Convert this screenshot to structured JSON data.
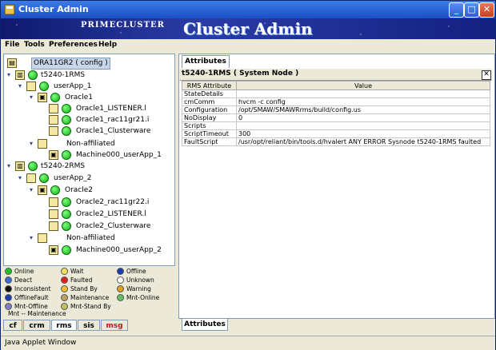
{
  "window": {
    "title": "Cluster Admin",
    "brand": "PRIMECLUSTER",
    "banner_title": "Cluster Admin",
    "buttons": [
      "_",
      "□",
      "✕"
    ]
  },
  "menu": [
    "File",
    "Tools",
    "Preferences",
    "Help"
  ],
  "tree": {
    "root": "ORA11GR2 ( config )",
    "nodes": [
      {
        "label": "t5240-1RMS"
      },
      {
        "label": "userApp_1"
      },
      {
        "label": "Oracle1"
      },
      {
        "label": "Oracle1_LISTENER.l"
      },
      {
        "label": "Oracle1_rac11gr21.i"
      },
      {
        "label": "Oracle1_Clusterware"
      },
      {
        "label": "Non-affiliated"
      },
      {
        "label": "Machine000_userApp_1"
      },
      {
        "label": "t5240-2RMS"
      },
      {
        "label": "userApp_2"
      },
      {
        "label": "Oracle2"
      },
      {
        "label": "Oracle2_rac11gr22.i"
      },
      {
        "label": "Oracle2_LISTENER.l"
      },
      {
        "label": "Oracle2_Clusterware"
      },
      {
        "label": "Non-affiliated"
      },
      {
        "label": "Machine000_userApp_2"
      }
    ]
  },
  "legend": [
    {
      "label": "Online",
      "color": "#22c022"
    },
    {
      "label": "Wait",
      "color": "#f0e060"
    },
    {
      "label": "Offline",
      "color": "#1a3ab0"
    },
    {
      "label": "Deact",
      "color": "#3a6ad0"
    },
    {
      "label": "Faulted",
      "color": "#e02020"
    },
    {
      "label": "Unknown",
      "color": "#ffffff"
    },
    {
      "label": "Inconsistent",
      "color": "#111111"
    },
    {
      "label": "Stand By",
      "color": "#f0c030"
    },
    {
      "label": "Warning",
      "color": "#e0a020"
    },
    {
      "label": "OfflineFault",
      "color": "#1a3ab0"
    },
    {
      "label": "Maintenance",
      "color": "#c0a060"
    },
    {
      "label": "Mnt-Online",
      "color": "#60c060"
    },
    {
      "label": "Mnt-Offline",
      "color": "#8080c0"
    },
    {
      "label": "Mnt-Stand By",
      "color": "#c0c060"
    },
    {
      "label": "Mnt -- Maintenance",
      "color": ""
    }
  ],
  "left_tabs": [
    {
      "label": "cf"
    },
    {
      "label": "crm"
    },
    {
      "label": "rms"
    },
    {
      "label": "sis"
    },
    {
      "label": "msg"
    }
  ],
  "right": {
    "tab": "Attributes",
    "header": "t5240-1RMS ( System Node )",
    "close": "✕",
    "columns": [
      "RMS Attribute",
      "Value"
    ],
    "rows": [
      [
        "StateDetails",
        ""
      ],
      [
        "cmComm",
        "hvcm -c config"
      ],
      [
        "Configuration",
        "/opt/SMAW/SMAWRrms/build/config.us"
      ],
      [
        "NoDisplay",
        "0"
      ],
      [
        "Scripts",
        ""
      ],
      [
        "ScriptTimeout",
        "300"
      ],
      [
        "FaultScript",
        "/usr/opt/reliant/bin/tools.d/hvalert ANY ERROR Sysnode t5240-1RMS faulted"
      ]
    ],
    "bottom_tab": "Attributes"
  },
  "status": "Java Applet Window"
}
